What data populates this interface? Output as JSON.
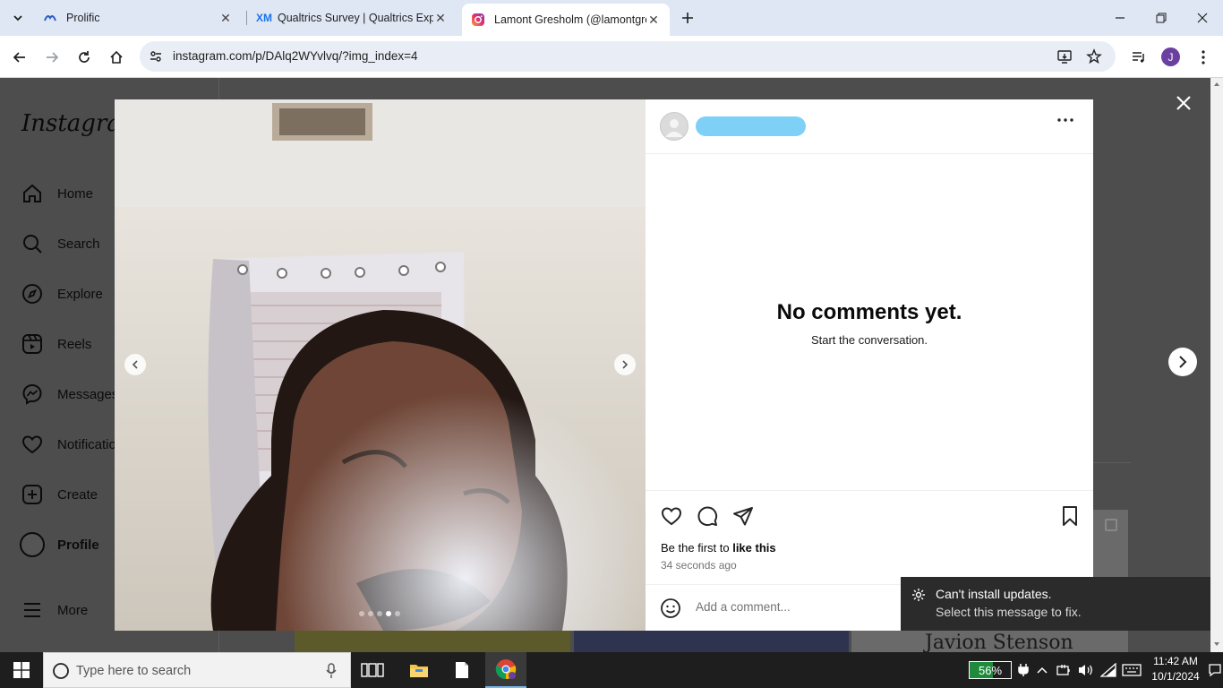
{
  "browser": {
    "tabs": [
      {
        "title": "Prolific",
        "icon": "prolific-icon"
      },
      {
        "title": "Qualtrics Survey | Qualtrics Expe",
        "icon": "qualtrics-xm-icon"
      },
      {
        "title": "Lamont Gresholm (@lamontgre",
        "icon": "instagram-icon"
      }
    ],
    "url": "instagram.com/p/DAlq2WYvlvq/?img_index=4",
    "profile_initial": "J"
  },
  "sidebar": {
    "logo": "Instagram",
    "items": [
      {
        "label": "Home",
        "icon": "home-icon"
      },
      {
        "label": "Search",
        "icon": "search-icon"
      },
      {
        "label": "Explore",
        "icon": "compass-icon"
      },
      {
        "label": "Reels",
        "icon": "reels-icon"
      },
      {
        "label": "Messages",
        "icon": "messenger-icon"
      },
      {
        "label": "Notifications",
        "icon": "heart-icon"
      },
      {
        "label": "Create",
        "icon": "plus-square-icon"
      },
      {
        "label": "Profile",
        "icon": "avatar-icon"
      },
      {
        "label": "More",
        "icon": "hamburger-icon"
      }
    ]
  },
  "post": {
    "carousel_count": 5,
    "carousel_active": 4,
    "no_comments_title": "No comments yet.",
    "no_comments_sub": "Start the conversation.",
    "likes_prefix": "Be the first to ",
    "likes_link": "like this",
    "timestamp": "34 seconds ago",
    "comment_placeholder": "Add a comment..."
  },
  "background": {
    "partial_text": "Javion Stenson"
  },
  "toast": {
    "title": "Can't install updates.",
    "message": "Select this message to fix."
  },
  "taskbar": {
    "search_placeholder": "Type here to search",
    "battery": "56%",
    "time": "11:42 AM",
    "date": "10/1/2024"
  },
  "colors": {
    "accent": "#1a73e8",
    "redacted": "#7fd0f7",
    "overlay": "#4d4d4d"
  }
}
